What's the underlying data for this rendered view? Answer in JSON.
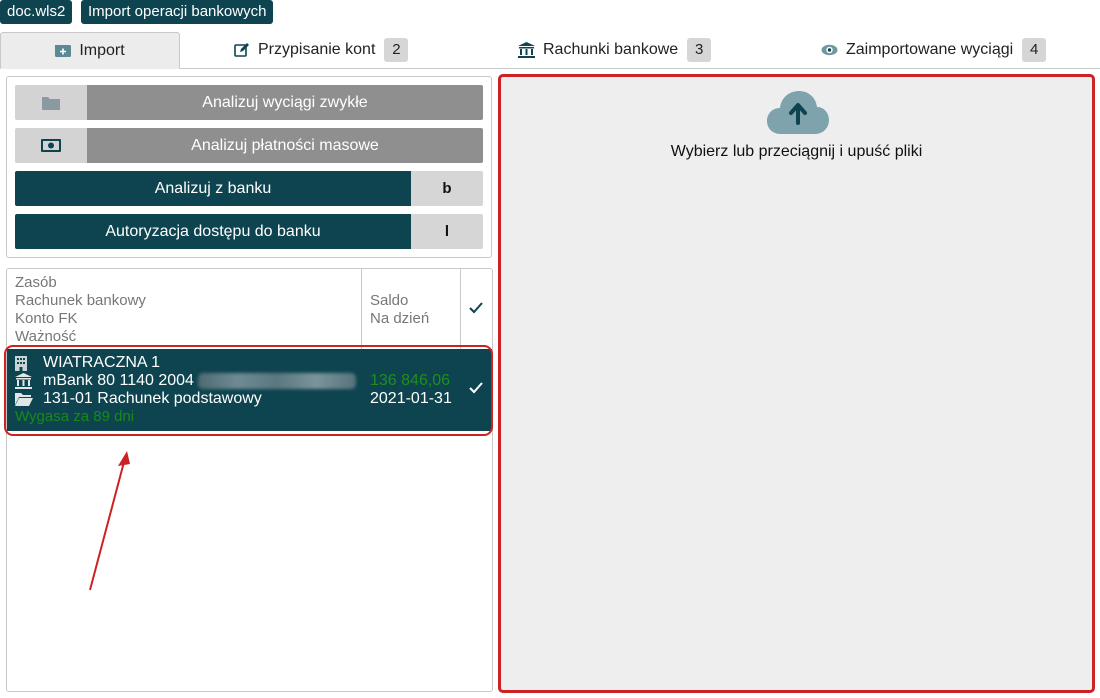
{
  "header": {
    "chip1": "doc.wls2",
    "chip2": "Import operacji bankowych"
  },
  "tabs": [
    {
      "label": "Import",
      "icon": "import-icon",
      "badge": ""
    },
    {
      "label": "Przypisanie kont",
      "icon": "edit-icon",
      "badge": "2"
    },
    {
      "label": "Rachunki bankowe",
      "icon": "bank-icon",
      "badge": "3"
    },
    {
      "label": "Zaimportowane wyciągi",
      "icon": "eye-icon",
      "badge": "4"
    }
  ],
  "actions": {
    "analyze_regular": "Analizuj wyciągi zwykłe",
    "analyze_mass": "Analizuj płatności masowe",
    "analyze_bank": "Analizuj z banku",
    "analyze_bank_key": "b",
    "authorize": "Autoryzacja dostępu do banku",
    "authorize_key": "l"
  },
  "table": {
    "header_col1": [
      "Zasób",
      "Rachunek bankowy",
      "Konto FK",
      "Ważność"
    ],
    "header_col2": [
      "Saldo",
      "Na dzień"
    ],
    "row": {
      "resource": "WIATRACZNA 1",
      "bank_account": "mBank 80 1140 2004",
      "fk_account": "131-01 Rachunek podstawowy",
      "validity": "Wygasa za 89 dni",
      "balance": "136 846,06",
      "date": "2021-01-31"
    }
  },
  "dropzone": {
    "text": "Wybierz lub przeciągnij i upuść pliki",
    "icon": "cloud-upload-icon"
  },
  "colors": {
    "accent": "#0e4450",
    "highlight": "#cc2222",
    "positive": "#1f8e1f"
  }
}
